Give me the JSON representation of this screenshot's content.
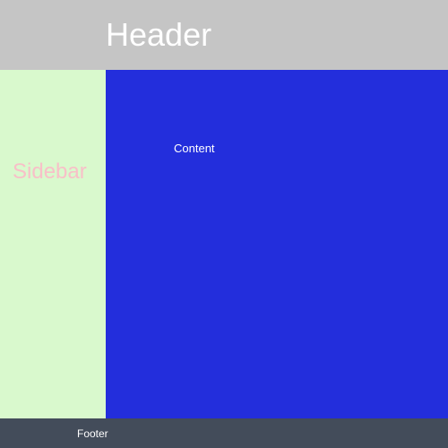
{
  "header": {
    "title": "Header"
  },
  "sidebar": {
    "label": "Sidebar"
  },
  "content": {
    "label": "Content"
  },
  "footer": {
    "label": "Footer"
  }
}
